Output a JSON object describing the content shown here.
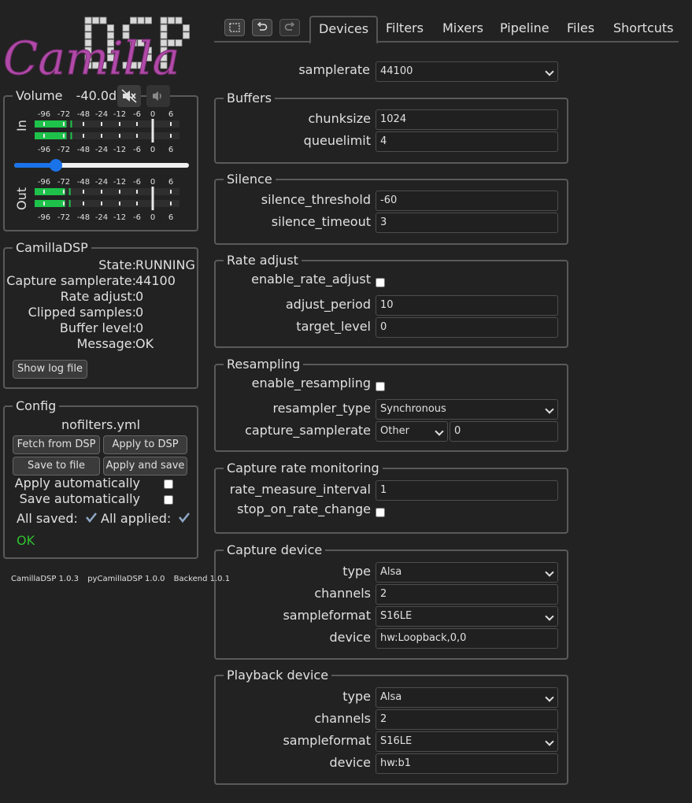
{
  "logo": {
    "word": "Camilla",
    "badge": "DSP"
  },
  "volume": {
    "label": "Volume",
    "value": "-40.0dB",
    "in_label": "In",
    "out_label": "Out",
    "scale": [
      "-96",
      "-72",
      "-48",
      "-24",
      "-12",
      "-6",
      "0",
      "6"
    ],
    "slider_fraction": 0.24,
    "in_levels": [
      0.22,
      0.22
    ],
    "out_levels": [
      0.21,
      0.21
    ],
    "level_color": "#1ec24a"
  },
  "status": {
    "title": "CamillaDSP",
    "rows": [
      {
        "key": "State:",
        "value": "RUNNING"
      },
      {
        "key": "Capture samplerate:",
        "value": "44100"
      },
      {
        "key": "Rate adjust:",
        "value": "0"
      },
      {
        "key": "Clipped samples:",
        "value": "0"
      },
      {
        "key": "Buffer level:",
        "value": "0"
      },
      {
        "key": "Message:",
        "value": "OK"
      }
    ],
    "show_log_label": "Show log file"
  },
  "config": {
    "title": "Config",
    "filename": "nofilters.yml",
    "fetch_label": "Fetch from DSP",
    "apply_label": "Apply to DSP",
    "save_label": "Save to file",
    "apply_save_label": "Apply and save",
    "apply_auto_label": "Apply automatically",
    "save_auto_label": "Save automatically",
    "all_saved_label": "All saved:",
    "all_applied_label": "All applied:",
    "ok_text": "OK",
    "ok_color": "#2fc22f"
  },
  "versions": {
    "camilladsp": "CamillaDSP 1.0.3",
    "pycamilladsp": "pyCamillaDSP 1.0.0",
    "backend": "Backend 1.0.1"
  },
  "tabs": [
    "Devices",
    "Filters",
    "Mixers",
    "Pipeline",
    "Files",
    "Shortcuts"
  ],
  "devices": {
    "samplerate_label": "samplerate",
    "samplerate": "44100",
    "buffers": {
      "title": "Buffers",
      "chunksize_label": "chunksize",
      "chunksize": "1024",
      "queuelimit_label": "queuelimit",
      "queuelimit": "4"
    },
    "silence": {
      "title": "Silence",
      "threshold_label": "silence_threshold",
      "threshold": "-60",
      "timeout_label": "silence_timeout",
      "timeout": "3"
    },
    "rate_adjust": {
      "title": "Rate adjust",
      "enable_label": "enable_rate_adjust",
      "period_label": "adjust_period",
      "period": "10",
      "target_label": "target_level",
      "target": "0"
    },
    "resampling": {
      "title": "Resampling",
      "enable_label": "enable_resampling",
      "type_label": "resampler_type",
      "type": "Synchronous",
      "capture_sr_label": "capture_samplerate",
      "capture_sr_mode": "Other",
      "capture_sr": "0"
    },
    "monitoring": {
      "title": "Capture rate monitoring",
      "interval_label": "rate_measure_interval",
      "interval": "1",
      "stop_label": "stop_on_rate_change"
    },
    "capture": {
      "title": "Capture device",
      "type_label": "type",
      "type": "Alsa",
      "channels_label": "channels",
      "channels": "2",
      "format_label": "sampleformat",
      "format": "S16LE",
      "device_label": "device",
      "device": "hw:Loopback,0,0"
    },
    "playback": {
      "title": "Playback device",
      "type_label": "type",
      "type": "Alsa",
      "channels_label": "channels",
      "channels": "2",
      "format_label": "sampleformat",
      "format": "S16LE",
      "device_label": "device",
      "device": "hw:b1"
    }
  }
}
